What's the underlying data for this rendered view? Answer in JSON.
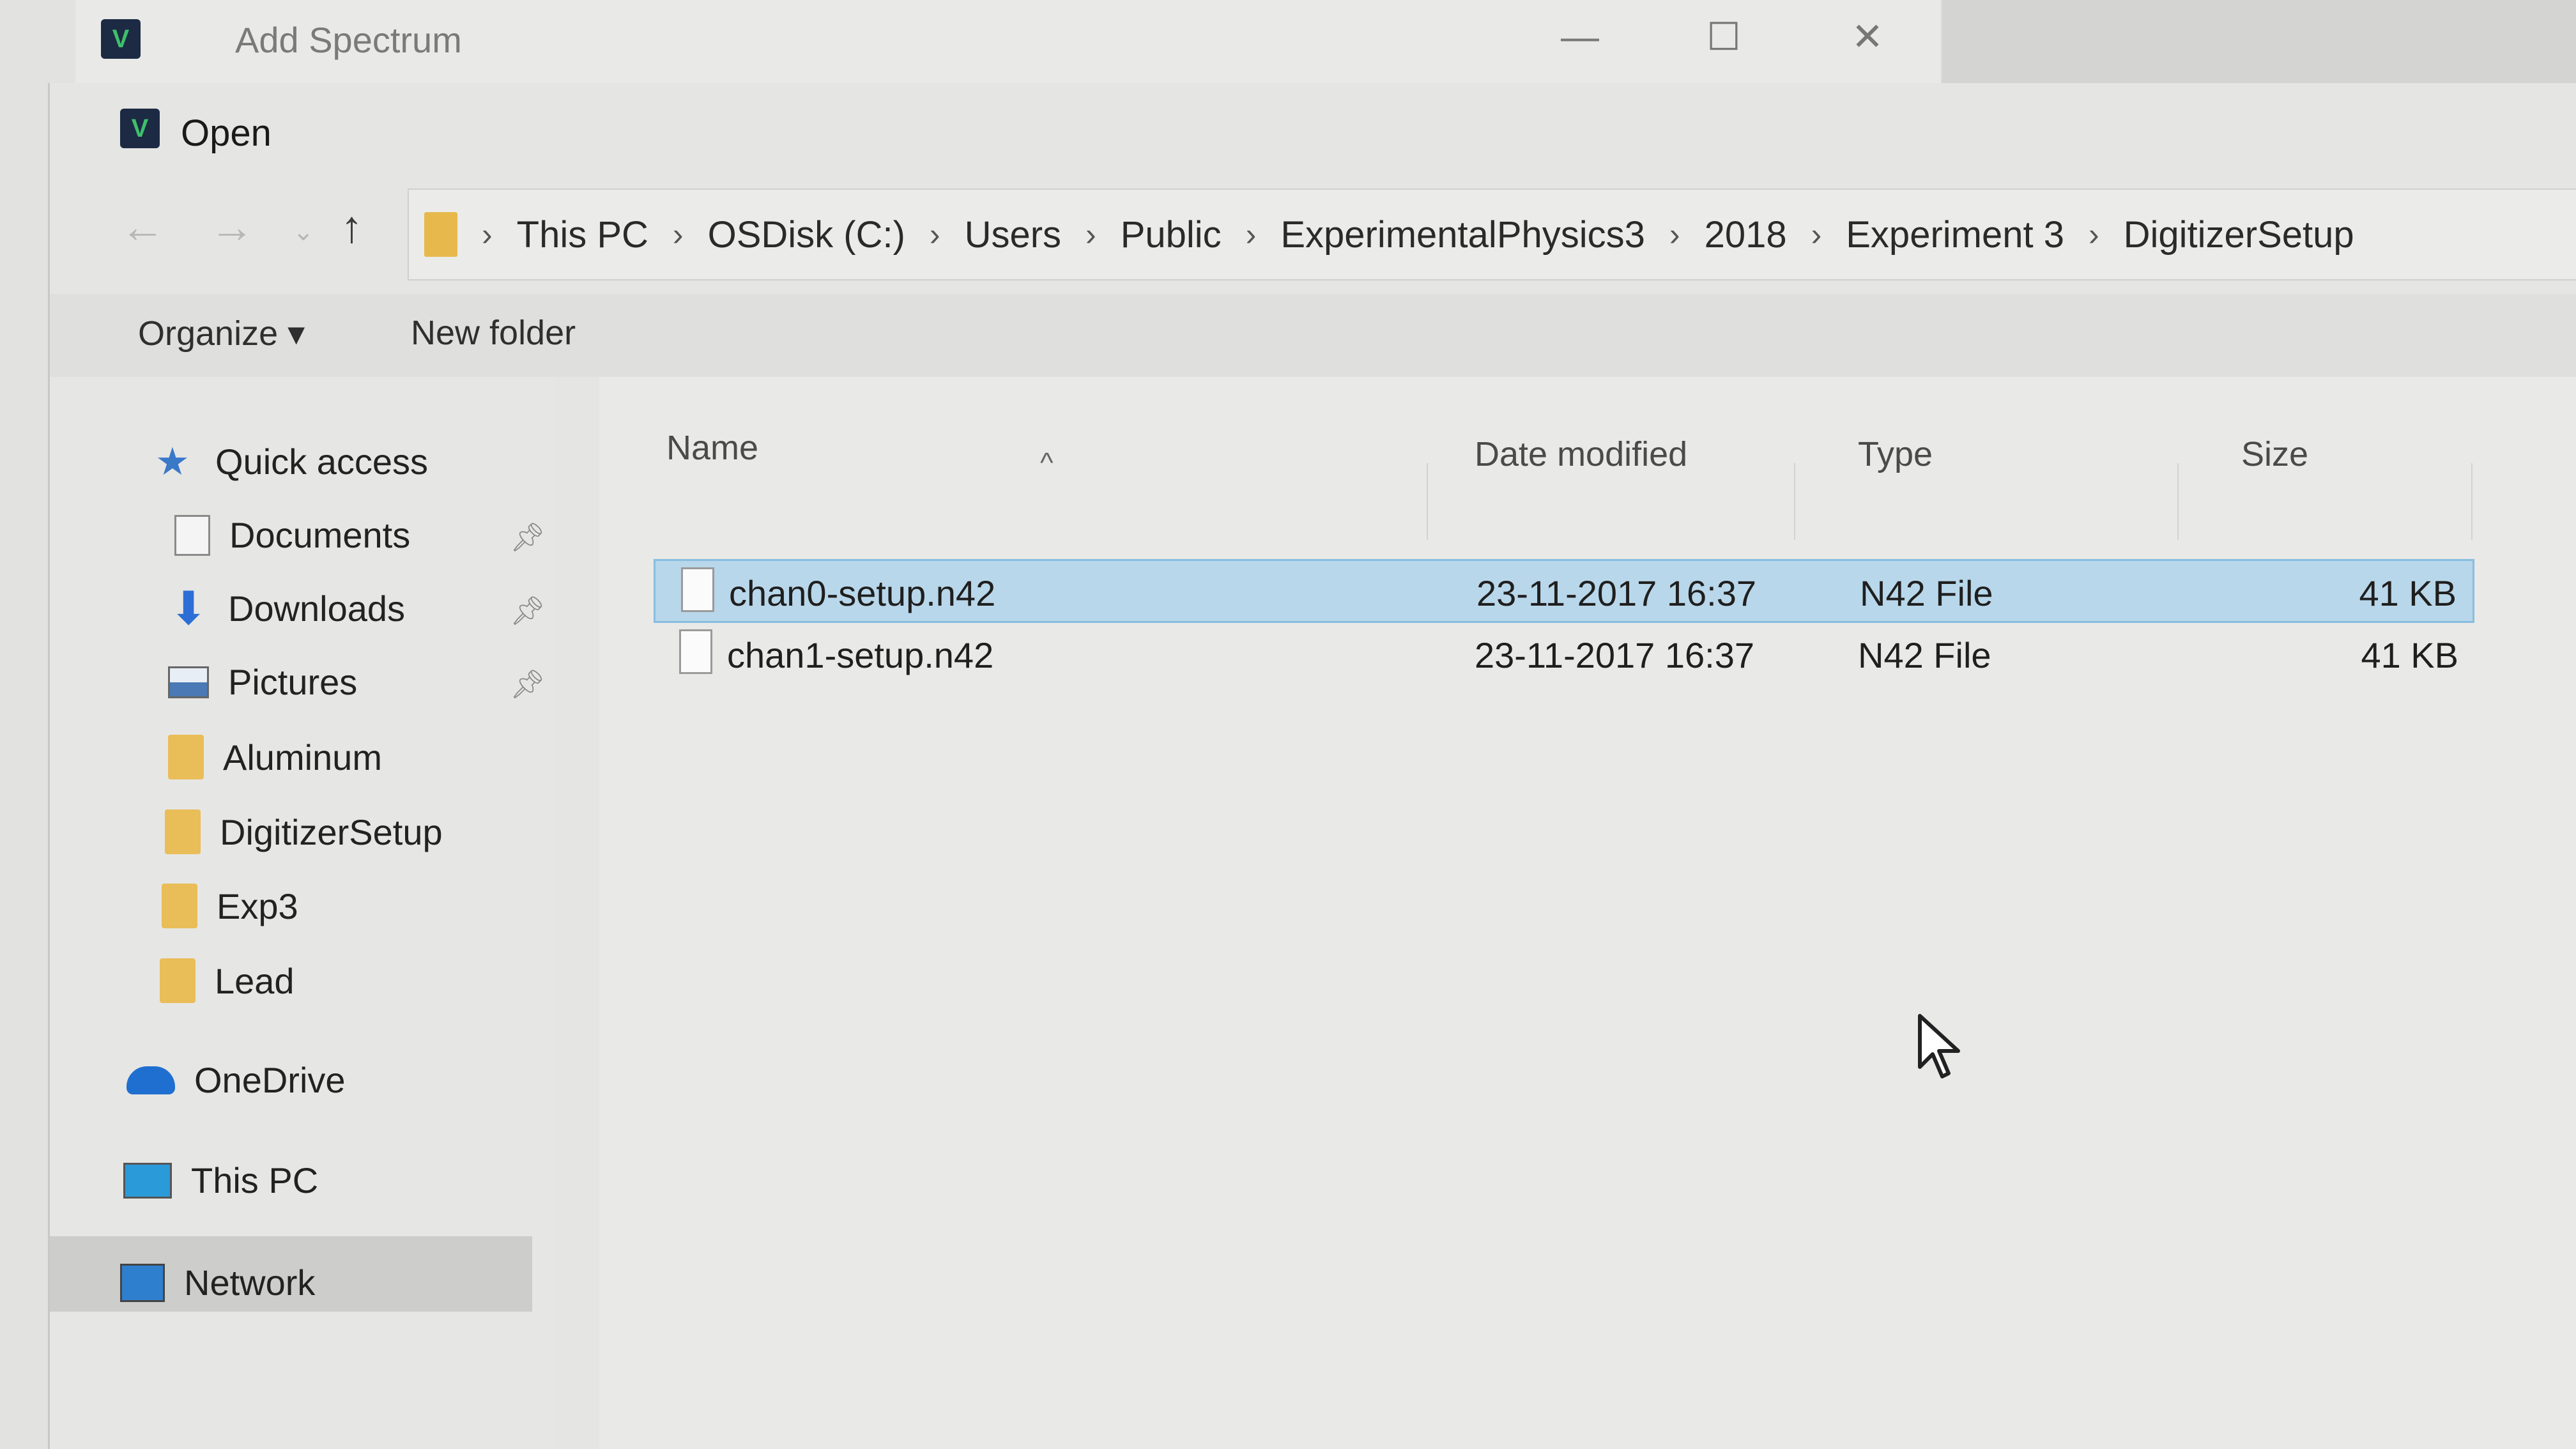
{
  "outer_window": {
    "title": "Add Spectrum",
    "app_icon_glyph": "V",
    "controls": {
      "minimize": "—",
      "maximize": "☐",
      "close": "✕"
    }
  },
  "dialog": {
    "title": "Open",
    "address": {
      "crumbs": [
        "This PC",
        "OSDisk (C:)",
        "Users",
        "Public",
        "ExperimentalPhysics3",
        "2018",
        "Experiment 3",
        "DigitizerSetup"
      ],
      "separator": "›"
    },
    "nav_buttons": {
      "back": "←",
      "forward": "→",
      "up": "↑"
    },
    "toolbar": {
      "organize_label": "Organize ▾",
      "new_folder_label": "New folder"
    },
    "nav_pane": {
      "quick_access": "Quick access",
      "items": [
        {
          "label": "Documents",
          "icon": "documents-icon",
          "pinned": true
        },
        {
          "label": "Downloads",
          "icon": "downloads-icon",
          "pinned": true
        },
        {
          "label": "Pictures",
          "icon": "pictures-icon",
          "pinned": true
        },
        {
          "label": "Aluminum",
          "icon": "folder-icon",
          "pinned": false
        },
        {
          "label": "DigitizerSetup",
          "icon": "folder-icon",
          "pinned": false
        },
        {
          "label": "Exp3",
          "icon": "folder-icon",
          "pinned": false
        },
        {
          "label": "Lead",
          "icon": "folder-icon",
          "pinned": false
        }
      ],
      "onedrive": "OneDrive",
      "this_pc": "This PC",
      "network": "Network"
    },
    "file_list": {
      "columns": {
        "name": "Name",
        "date": "Date modified",
        "type": "Type",
        "size": "Size"
      },
      "files": [
        {
          "name": "chan0-setup.n42",
          "date": "23-11-2017 16:37",
          "type": "N42 File",
          "size": "41 KB",
          "selected": true
        },
        {
          "name": "chan1-setup.n42",
          "date": "23-11-2017 16:37",
          "type": "N42 File",
          "size": "41 KB",
          "selected": false
        }
      ]
    }
  },
  "colors": {
    "selection": "#b9d7ea",
    "selection_border": "#88bde0",
    "folder": "#e9bd58",
    "app_icon_bg": "#1c2a44"
  }
}
